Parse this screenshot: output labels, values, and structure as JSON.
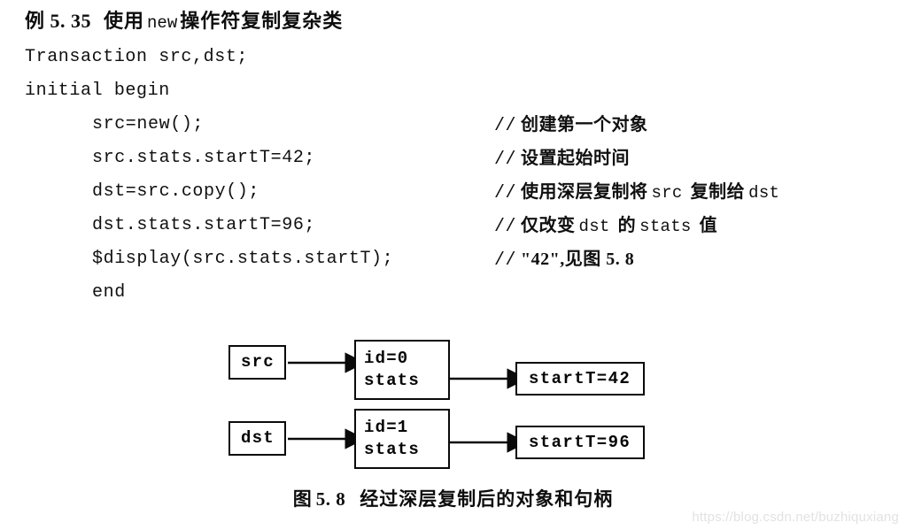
{
  "heading": {
    "number": "例 5. 35",
    "text_before": "使用",
    "keyword": "new",
    "text_after": "操作符复制复杂类"
  },
  "code": {
    "lines": [
      {
        "text": "Transaction src,dst;",
        "indent": false,
        "comment_slashes": "",
        "comment_cjk": "",
        "comment_mono": "",
        "comment_cjk2": ""
      },
      {
        "text": "initial begin",
        "indent": false,
        "comment_slashes": "",
        "comment_cjk": "",
        "comment_mono": "",
        "comment_cjk2": ""
      },
      {
        "text": "src=new();",
        "indent": true,
        "comment_slashes": "//",
        "comment_cjk": "创建第一个对象",
        "comment_mono": "",
        "comment_cjk2": ""
      },
      {
        "text": "src.stats.startT=42;",
        "indent": true,
        "comment_slashes": "//",
        "comment_cjk": "设置起始时间",
        "comment_mono": "",
        "comment_cjk2": ""
      },
      {
        "text": "dst=src.copy();",
        "indent": true,
        "comment_slashes": "//",
        "comment_cjk": "使用深层复制将",
        "comment_mono": "src",
        "comment_cjk2": "复制给",
        "comment_mono2": "dst"
      },
      {
        "text": "dst.stats.startT=96;",
        "indent": true,
        "comment_slashes": "//",
        "comment_cjk": "仅改变",
        "comment_mono": "dst",
        "comment_cjk2": "的",
        "comment_mono2": "stats",
        "comment_cjk3": "值"
      },
      {
        "text": "$display(src.stats.startT);",
        "indent": true,
        "comment_slashes": "//",
        "comment_cjk": "\"42\",见图 5. 8",
        "comment_mono": "",
        "comment_cjk2": ""
      },
      {
        "text": "end",
        "indent": true,
        "comment_slashes": "",
        "comment_cjk": "",
        "comment_mono": "",
        "comment_cjk2": ""
      }
    ]
  },
  "diagram": {
    "handle_src": "src",
    "handle_dst": "dst",
    "object0_id": "id=0",
    "object0_stats": "stats",
    "object1_id": "id=1",
    "object1_stats": "stats",
    "stats0_value": "startT=42",
    "stats1_value": "startT=96"
  },
  "caption": {
    "label": "图",
    "number": "5. 8",
    "text": "经过深层复制后的对象和句柄"
  },
  "watermark": "https://blog.csdn.net/buzhiquxiang"
}
